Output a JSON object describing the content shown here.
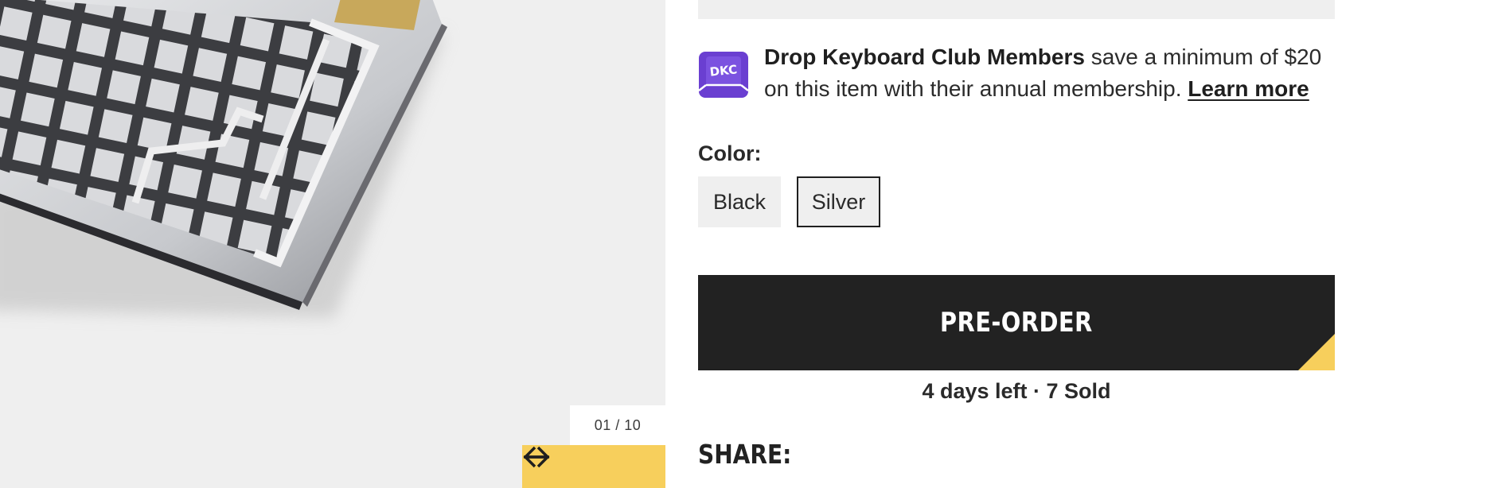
{
  "gallery": {
    "counter": "01 / 10",
    "prev_icon": "arrow-left-icon",
    "next_icon": "arrow-right-icon"
  },
  "membership": {
    "logo_text": "DKC",
    "bold_text": "Drop Keyboard Club Members",
    "text": " save a minimum of $20 on this item with their annual membership. ",
    "link": "Learn more"
  },
  "color": {
    "label": "Color:",
    "options": [
      "Black",
      "Silver"
    ],
    "selected": "Silver"
  },
  "cta": {
    "label": "PRE-ORDER",
    "status": "4 days left · 7 Sold"
  },
  "share": {
    "label": "SHARE:"
  },
  "colors": {
    "accent_yellow": "#f7cf5c",
    "dkc_purple": "#6a3fd1",
    "button_dark": "#222222",
    "panel_grey": "#efefef"
  }
}
